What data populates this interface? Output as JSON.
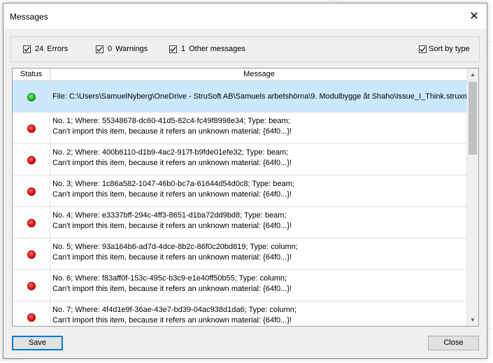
{
  "window": {
    "title": "Messages"
  },
  "filters": {
    "errors": {
      "checked": true,
      "count": "24",
      "label": "Errors"
    },
    "warnings": {
      "checked": true,
      "count": "0",
      "label": "Warnings"
    },
    "other": {
      "checked": true,
      "count": "1",
      "label": "Other messages"
    },
    "sort": {
      "checked": true,
      "label": "Sort by type"
    }
  },
  "table": {
    "columns": [
      "Status",
      "Message"
    ],
    "rows": [
      {
        "status": "green",
        "selected": true,
        "line1": "File: C:\\Users\\SamuelNyberg\\OneDrive - StruSoft AB\\Samuels arbetshörna\\9. Modulbygge åt Shaho\\Issue_I_Think.struxml",
        "line2": ""
      },
      {
        "status": "red",
        "line1": "No. 1;   Where: 55348678-dc60-41d5-82c4-fc49f8998e34;   Type: beam;",
        "line2": "Can't import this item, because it refers an unknown material: {64f0...}!"
      },
      {
        "status": "red",
        "line1": "No. 2;   Where: 400b6110-d1b9-4ac2-917f-b9fde01efe32;   Type: beam;",
        "line2": "Can't import this item, because it refers an unknown material: {64f0...}!"
      },
      {
        "status": "red",
        "line1": "No. 3;   Where: 1c86a582-1047-46b0-bc7a-61644d54d0c8;   Type: beam;",
        "line2": "Can't import this item, because it refers an unknown material: {64f0...}!"
      },
      {
        "status": "red",
        "line1": "No. 4;   Where: e3337bff-294c-4ff3-8651-d1ba72dd9bd8;   Type: beam;",
        "line2": "Can't import this item, because it refers an unknown material: {64f0...}!"
      },
      {
        "status": "red",
        "line1": "No. 5;   Where: 93a164b6-ad7d-4dce-8b2c-86f0c20bd819;   Type: column;",
        "line2": "Can't import this item, because it refers an unknown material: {64f0...}!"
      },
      {
        "status": "red",
        "line1": "No. 6;   Where: f83aff0f-153c-495c-b3c9-e1e40ff50b55;   Type: column;",
        "line2": "Can't import this item, because it refers an unknown material: {64f0...}!"
      },
      {
        "status": "red",
        "line1": "No. 7;   Where: 4f4d1e9f-36ae-43e7-bd39-04ac938d1da6;   Type: column;",
        "line2": "Can't import this item, because it refers an unknown material: {64f0...}!"
      }
    ]
  },
  "buttons": {
    "save": "Save",
    "close": "Close"
  },
  "colors": {
    "selected_row": "#cce8ff",
    "error_dot": "#e01010",
    "info_dot": "#16c016",
    "focus_border": "#0078d7"
  }
}
